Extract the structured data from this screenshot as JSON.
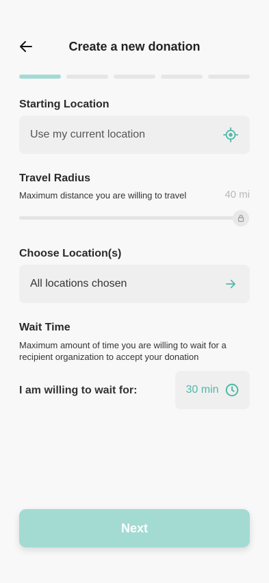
{
  "header": {
    "title": "Create a new donation",
    "back_icon": "arrow-left-icon"
  },
  "progress": {
    "total_steps": 5,
    "current_step": 1
  },
  "starting_location": {
    "label": "Starting Location",
    "placeholder": "Use my current location",
    "icon": "crosshair-location-icon"
  },
  "travel_radius": {
    "label": "Travel Radius",
    "description": "Maximum distance you are willing to travel",
    "value": "40 mi",
    "slider_fraction": 1.0
  },
  "choose_locations": {
    "label": "Choose Location(s)",
    "value": "All locations chosen",
    "icon": "arrow-right-icon"
  },
  "wait_time": {
    "label": "Wait Time",
    "description": "Maximum amount of time you are willing to wait for a recipient organization to accept your donation",
    "row_label": "I am willing to wait for:",
    "value": "30 min",
    "icon": "clock-icon"
  },
  "footer": {
    "next_label": "Next"
  },
  "colors": {
    "accent": "#4fb8a8",
    "accent_light": "#a3dbd3",
    "field_bg": "#efefef",
    "background": "#f8f8f8"
  }
}
